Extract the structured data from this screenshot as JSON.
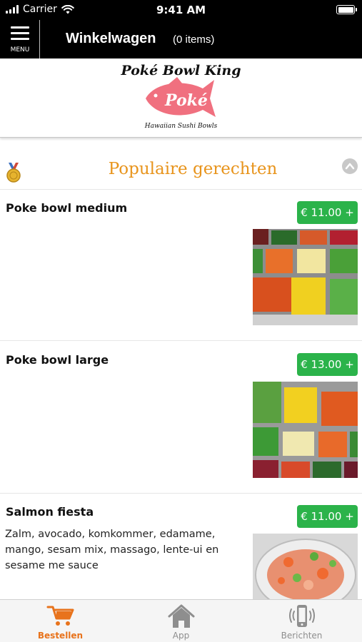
{
  "status_bar": {
    "carrier": "Carrier",
    "time": "9:41 AM"
  },
  "nav": {
    "menu_label": "MENU",
    "title": "Winkelwagen",
    "item_count": "(0 items)"
  },
  "logo": {
    "title": "Poké Bowl King",
    "fish_text": "Poké",
    "subtitle": "Hawaiian Sushi Bowls",
    "fish_color": "#f0707f"
  },
  "section": {
    "title": "Populaire gerechten",
    "title_color": "#e8941c"
  },
  "products": [
    {
      "name": "Poke bowl medium",
      "price": "€ 11.00 +",
      "description": "",
      "photo": "prep-containers-vegetables"
    },
    {
      "name": "Poke bowl large",
      "price": "€ 13.00 +",
      "description": "",
      "photo": "prep-containers-vegetables"
    },
    {
      "name": "Salmon fiesta",
      "price": "€ 11.00 +",
      "description": "Zalm, avocado, komkommer, edamame, mango, sesam mix, massago, lente-ui en sesame me sauce",
      "photo": "salmon-bowl"
    }
  ],
  "tabs": [
    {
      "label": "Bestellen",
      "icon": "cart-icon",
      "active": true
    },
    {
      "label": "App",
      "icon": "home-icon",
      "active": false
    },
    {
      "label": "Berichten",
      "icon": "phone-vibrate-icon",
      "active": false
    }
  ],
  "colors": {
    "accent": "#e8731c",
    "price_button": "#2bb34a"
  }
}
